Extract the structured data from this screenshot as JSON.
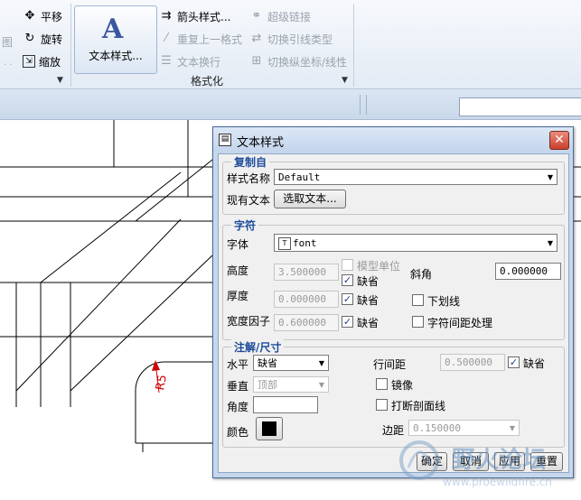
{
  "ribbon": {
    "left_items": [
      {
        "label": "平移",
        "icon": "pan-icon"
      },
      {
        "label": "旋转",
        "icon": "rotate-icon"
      },
      {
        "label": "缩放",
        "icon": "zoom-icon"
      }
    ],
    "left_partial": "图",
    "text_style_button": "文本样式...",
    "format_items": [
      {
        "label": "箭头样式...",
        "icon": "arrow-style-icon",
        "enabled": true
      },
      {
        "label": "重复上一格式",
        "icon": "repeat-format-icon",
        "enabled": false
      },
      {
        "label": "文本换行",
        "icon": "text-wrap-icon",
        "enabled": false
      },
      {
        "label": "超级链接",
        "icon": "hyperlink-icon",
        "enabled": false
      },
      {
        "label": "切换引线类型",
        "icon": "toggle-leader-icon",
        "enabled": false
      },
      {
        "label": "切换纵坐标/线性",
        "icon": "toggle-ordinate-icon",
        "enabled": false
      }
    ],
    "group_label": "格式化"
  },
  "drawing": {
    "dimension_label": "R5"
  },
  "dialog": {
    "title": "文本样式",
    "copy_from": {
      "legend": "复制自",
      "style_name_label": "样式名称",
      "style_name_value": "Default",
      "existing_text_label": "现有文本",
      "select_text_button": "选取文本..."
    },
    "chars": {
      "legend": "字符",
      "font_label": "字体",
      "font_value": "font",
      "model_units_label": "模型单位",
      "height_label": "高度",
      "height_value": "3.500000",
      "default_label": "缺省",
      "thickness_label": "厚度",
      "thickness_value": "0.000000",
      "width_factor_label": "宽度因子",
      "width_factor_value": "0.600000",
      "slant_label": "斜角",
      "slant_value": "0.000000",
      "underline_label": "下划线",
      "char_spacing_label": "字符间距处理"
    },
    "note": {
      "legend": "注解/尺寸",
      "horizontal_label": "水平",
      "horizontal_value": "缺省",
      "vertical_label": "垂直",
      "vertical_value": "顶部",
      "angle_label": "角度",
      "angle_value": "",
      "color_label": "颜色",
      "line_spacing_label": "行间距",
      "line_spacing_value": "0.500000",
      "default_label": "缺省",
      "mirror_label": "镜像",
      "break_hatch_label": "打断剖面线",
      "margin_label": "边距",
      "margin_value": "0.150000",
      "color_value": "#000000"
    },
    "buttons": {
      "ok": "确定",
      "cancel": "取消",
      "apply": "应用",
      "reset": "重置"
    }
  },
  "watermark": {
    "text": "野火论坛",
    "url": "www.proewildfire.cn"
  }
}
